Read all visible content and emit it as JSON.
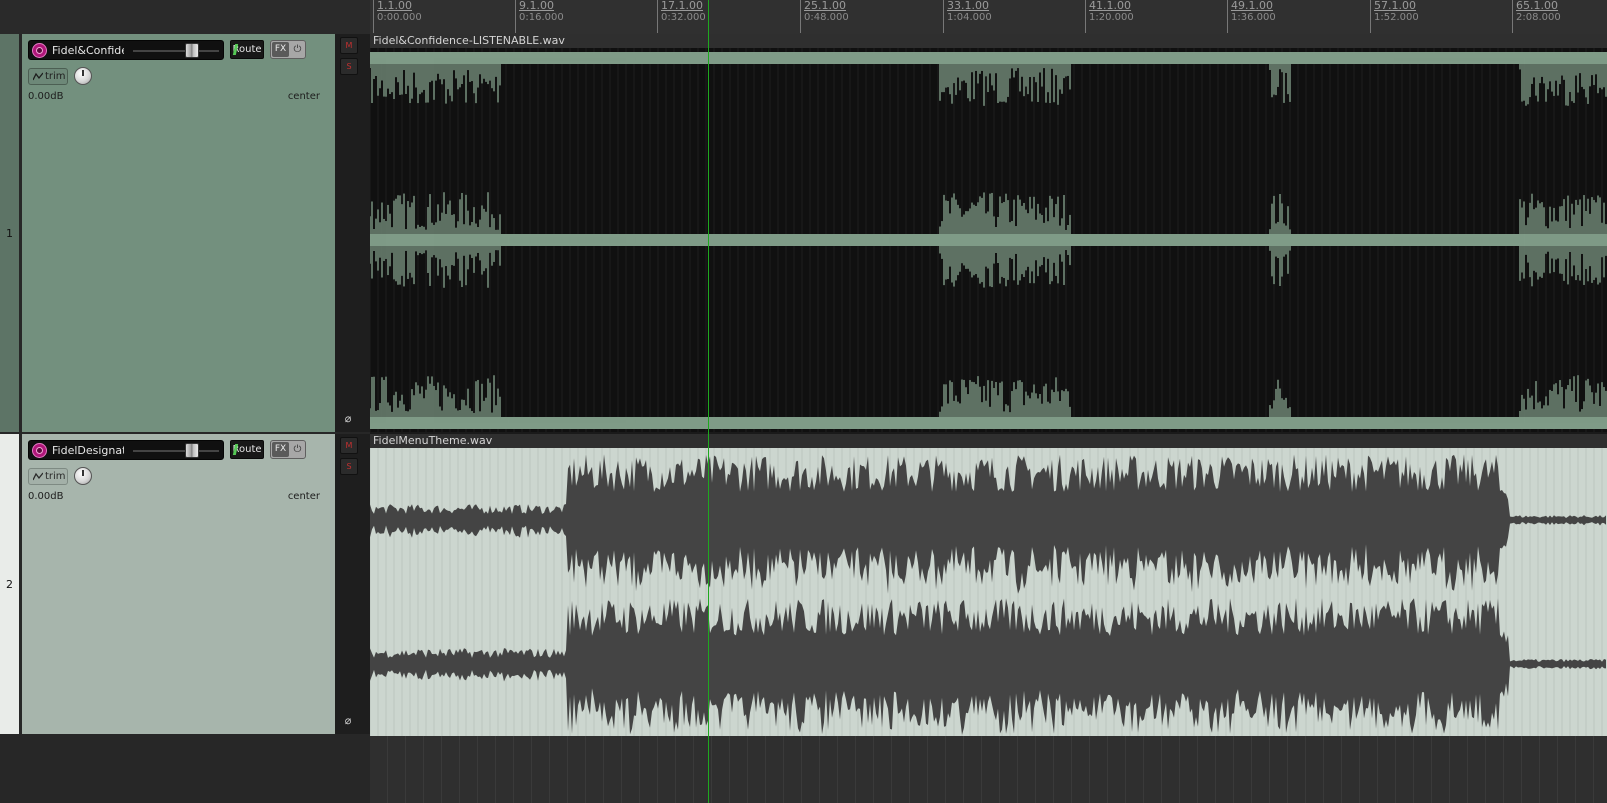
{
  "tracks": [
    {
      "number": "1",
      "name": "Fidel&Confide",
      "route_label": "Route",
      "fx_label": "FX",
      "trim_label": "trim",
      "volume": "0.00dB",
      "pan": "center",
      "mute_label": "M",
      "solo_label": "S",
      "phase_symbol": "⌀",
      "panel_color": "#73907e",
      "selected": false
    },
    {
      "number": "2",
      "name": "FidelDesignat",
      "route_label": "Route",
      "fx_label": "FX",
      "trim_label": "trim",
      "volume": "0.00dB",
      "pan": "center",
      "mute_label": "M",
      "solo_label": "S",
      "phase_symbol": "⌀",
      "panel_color": "#a7b5ac",
      "selected": true
    }
  ],
  "ruler": {
    "markers": [
      {
        "bar": "1.1.00",
        "time": "0:00.000"
      },
      {
        "bar": "9.1.00",
        "time": "0:16.000"
      },
      {
        "bar": "17.1.00",
        "time": "0:32.000"
      },
      {
        "bar": "25.1.00",
        "time": "0:48.000"
      },
      {
        "bar": "33.1.00",
        "time": "1:04.000"
      },
      {
        "bar": "41.1.00",
        "time": "1:20.000"
      },
      {
        "bar": "49.1.00",
        "time": "1:36.000"
      },
      {
        "bar": "57.1.00",
        "time": "1:52.000"
      },
      {
        "bar": "65.1.00",
        "time": "2:08.000"
      }
    ]
  },
  "items": [
    {
      "name": "Fidel&Confidence-LISTENABLE.wav",
      "color": "#7a9482",
      "wave_color": "#7f9b87",
      "background": "#101010"
    },
    {
      "name": "FidelMenuTheme.wav",
      "color": "#ccd6cf",
      "wave_color": "#444444",
      "background": "#ccd6cf"
    }
  ],
  "playback": {
    "cursor_time": "0:32.000"
  },
  "icons": {
    "record_arm": "record-arm-icon",
    "trim_envelope": "envelope-icon",
    "pan_knob": "pan-knob-icon",
    "fx_bypass": "power-icon",
    "phase": "phase-invert-icon"
  }
}
